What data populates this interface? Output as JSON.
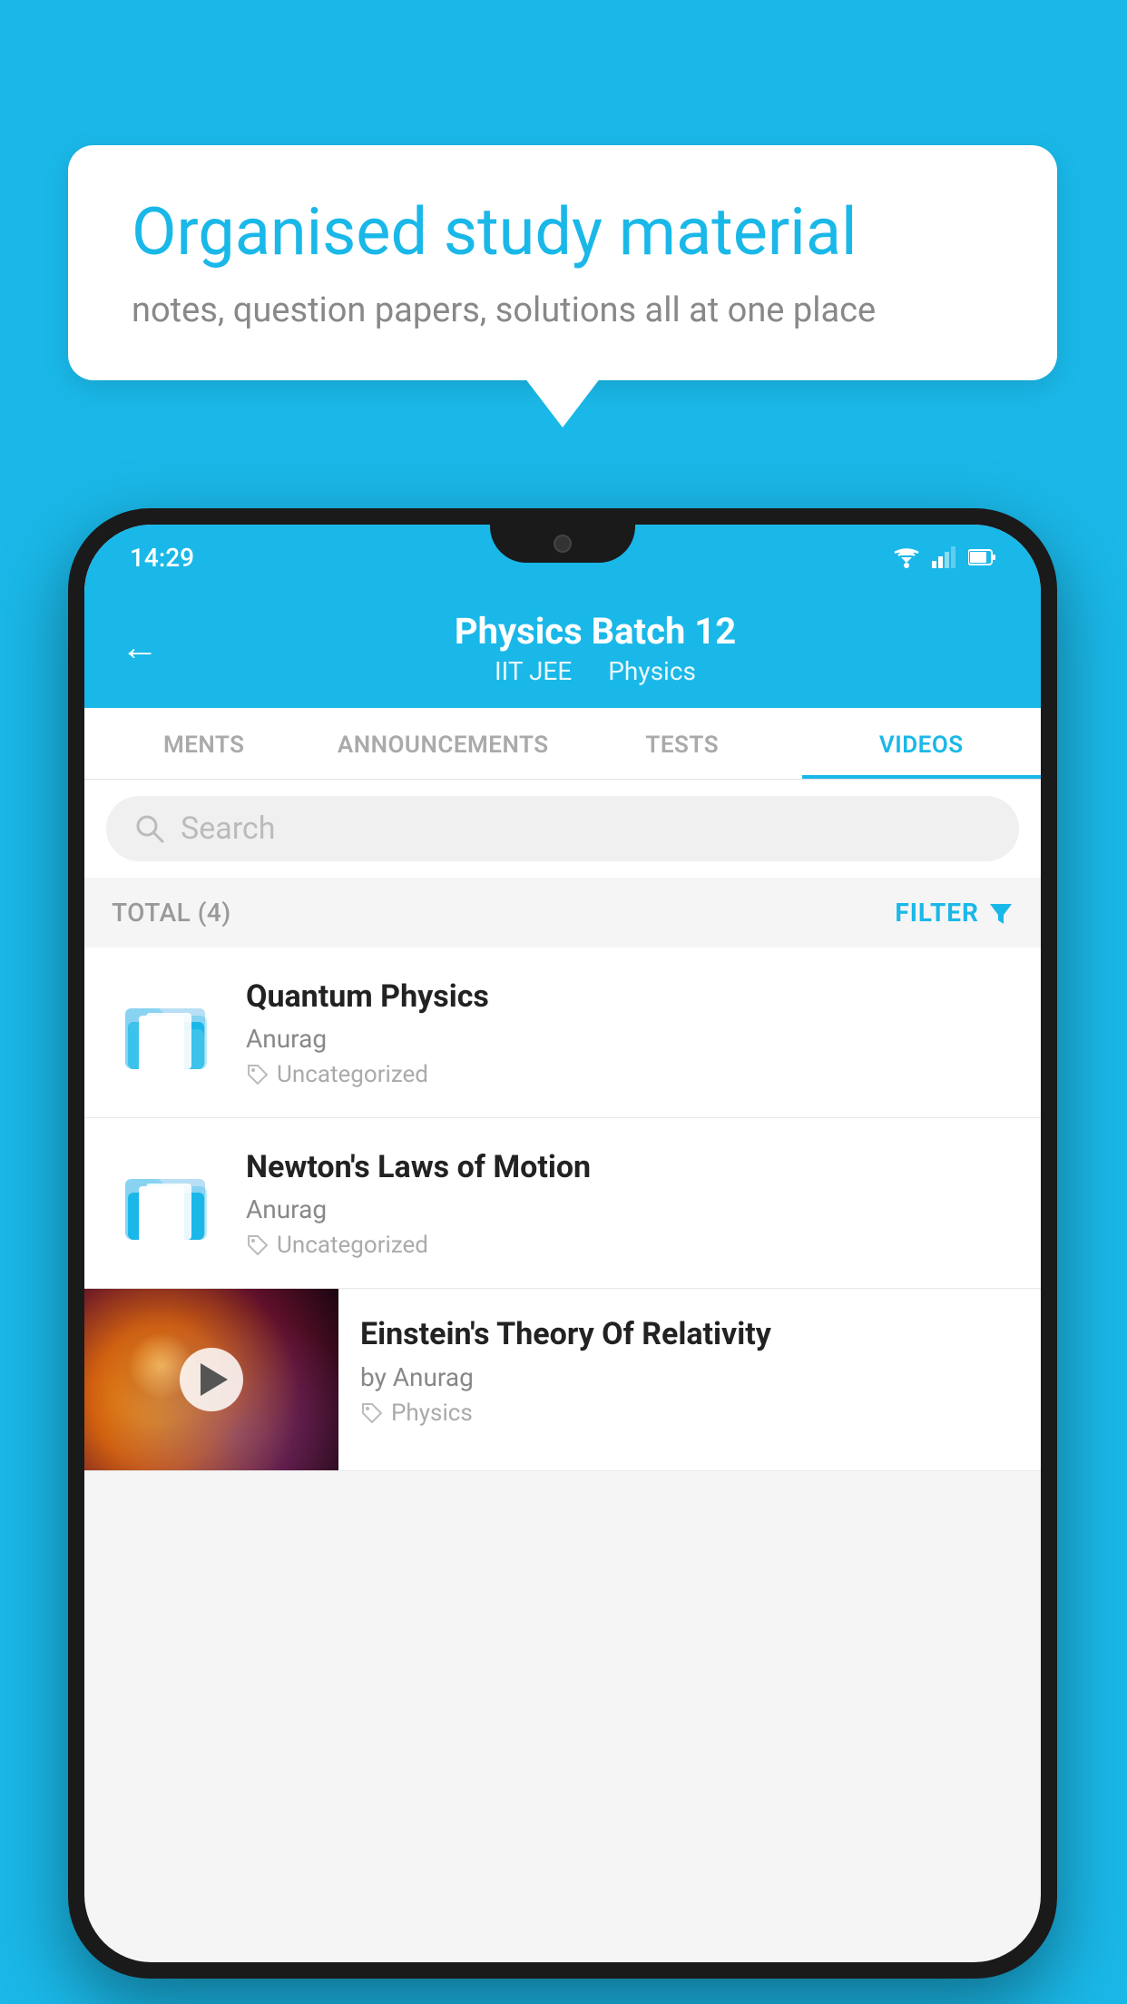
{
  "background": {
    "color": "#1ab8e8"
  },
  "speech_bubble": {
    "title": "Organised study material",
    "subtitle": "notes, question papers, solutions all at one place"
  },
  "phone": {
    "status_bar": {
      "time": "14:29"
    },
    "header": {
      "title": "Physics Batch 12",
      "subtitle1": "IIT JEE",
      "subtitle2": "Physics",
      "back_label": "←"
    },
    "tabs": [
      {
        "label": "MENTS",
        "active": false
      },
      {
        "label": "ANNOUNCEMENTS",
        "active": false
      },
      {
        "label": "TESTS",
        "active": false
      },
      {
        "label": "VIDEOS",
        "active": true
      }
    ],
    "search": {
      "placeholder": "Search"
    },
    "filter_bar": {
      "total_label": "TOTAL (4)",
      "filter_label": "FILTER"
    },
    "videos": [
      {
        "id": 1,
        "title": "Quantum Physics",
        "author": "Anurag",
        "tag": "Uncategorized",
        "has_thumbnail": false
      },
      {
        "id": 2,
        "title": "Newton's Laws of Motion",
        "author": "Anurag",
        "tag": "Uncategorized",
        "has_thumbnail": false
      },
      {
        "id": 3,
        "title": "Einstein's Theory Of Relativity",
        "author": "by Anurag",
        "tag": "Physics",
        "has_thumbnail": true
      }
    ]
  }
}
